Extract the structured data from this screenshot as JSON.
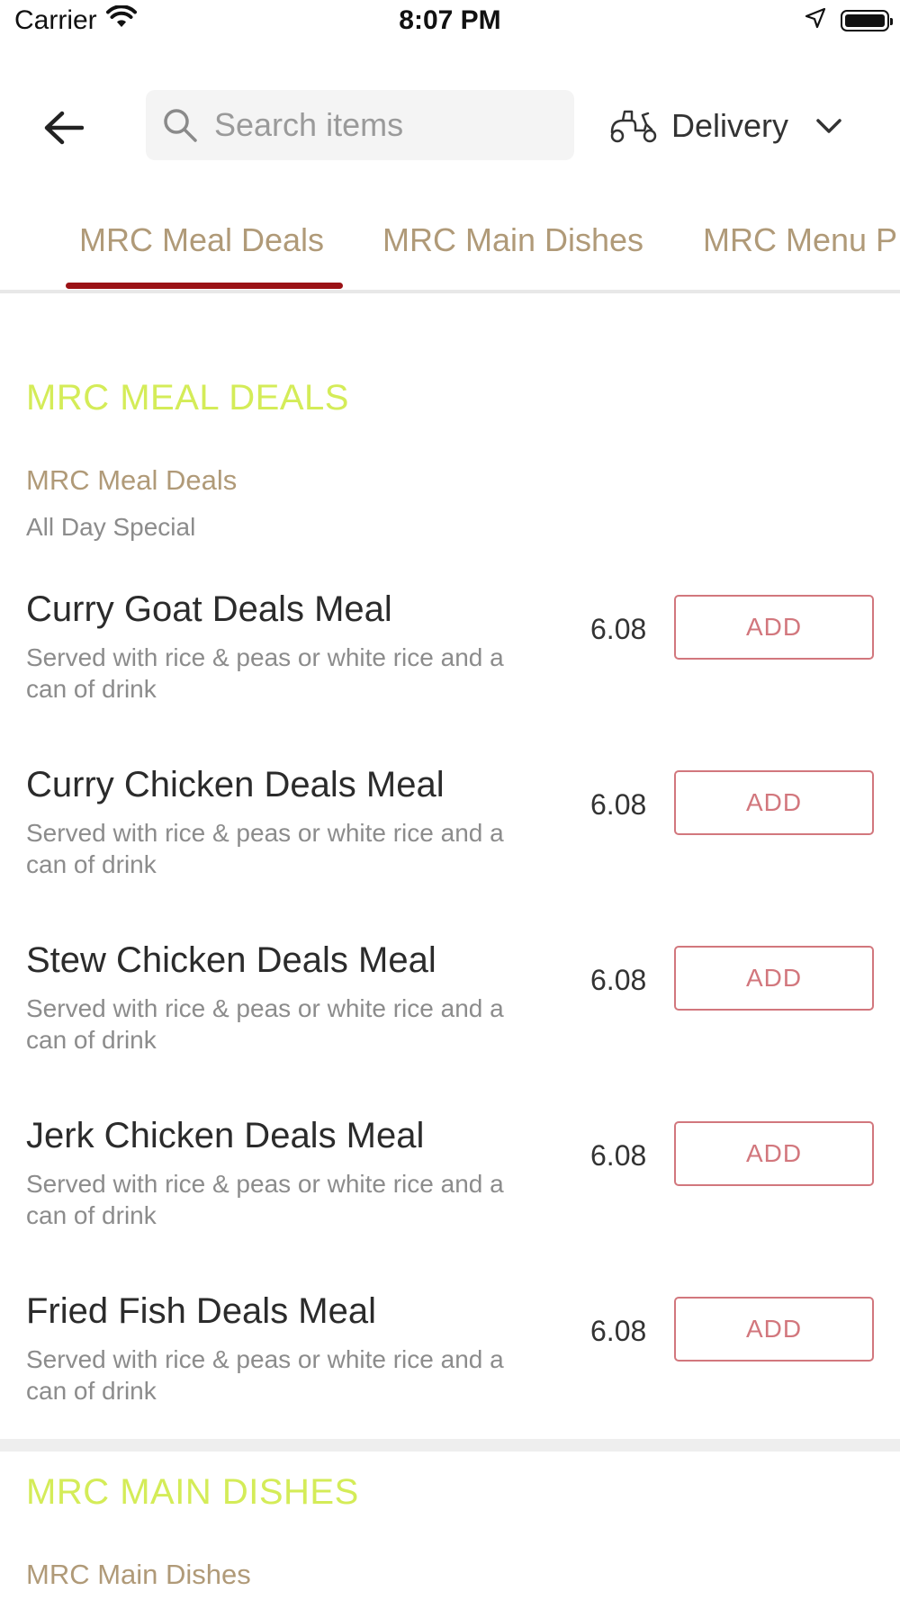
{
  "status_bar": {
    "carrier": "Carrier",
    "time": "8:07 PM"
  },
  "header": {
    "search_placeholder": "Search items",
    "delivery_label": "Delivery"
  },
  "tabs": [
    {
      "label": "MRC Meal Deals",
      "active": true
    },
    {
      "label": "MRC Main Dishes",
      "active": false
    },
    {
      "label": "MRC Menu P",
      "active": false
    }
  ],
  "sections": [
    {
      "title": "MRC MEAL DEALS",
      "subcategory": "MRC Meal Deals",
      "subcategory_desc": "All Day Special",
      "items": [
        {
          "name": "Curry Goat Deals Meal",
          "desc": "Served with rice & peas or white rice and a can of drink",
          "price": "6.08",
          "button": "ADD"
        },
        {
          "name": "Curry Chicken Deals Meal",
          "desc": "Served with rice & peas or white rice and a can of drink",
          "price": "6.08",
          "button": "ADD"
        },
        {
          "name": "Stew Chicken Deals Meal",
          "desc": "Served with rice & peas or white rice and a can of drink",
          "price": "6.08",
          "button": "ADD"
        },
        {
          "name": "Jerk Chicken Deals Meal",
          "desc": "Served with rice & peas or white rice and a can of drink",
          "price": "6.08",
          "button": "ADD"
        },
        {
          "name": "Fried Fish Deals Meal",
          "desc": "Served with rice & peas or white rice and a can of drink",
          "price": "6.08",
          "button": "ADD"
        }
      ]
    },
    {
      "title": "MRC MAIN DISHES",
      "subcategory": "MRC Main Dishes"
    }
  ],
  "colors": {
    "accent": "#9b1216",
    "tab_text": "#b09a78",
    "section_title": "#d4ec58",
    "add_button": "#d2777d"
  }
}
